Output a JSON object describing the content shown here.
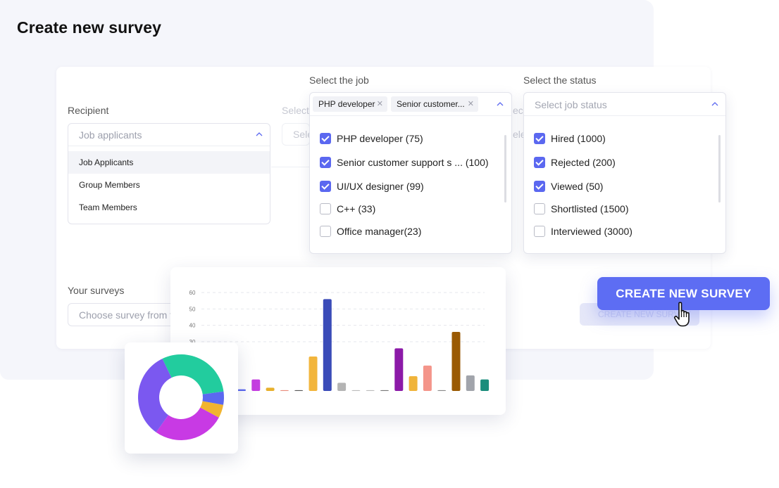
{
  "page": {
    "title": "Create new survey"
  },
  "recipient": {
    "label": "Recipient",
    "placeholder": "Job applicants",
    "options": [
      "Job Applicants",
      "Group Members",
      "Team Members"
    ]
  },
  "background_fields": {
    "select_label": "Select",
    "select_value": "Sele",
    "select_label_2": "ect",
    "select_value_2": "ele"
  },
  "job": {
    "label": "Select the job",
    "chips": [
      "PHP developer",
      "Senior customer..."
    ],
    "options": [
      {
        "label": "PHP developer (75)",
        "checked": true
      },
      {
        "label": "Senior customer support s ... (100)",
        "checked": true
      },
      {
        "label": "UI/UX designer (99)",
        "checked": true
      },
      {
        "label": "C++ (33)",
        "checked": false
      },
      {
        "label": "Office manager(23)",
        "checked": false
      }
    ]
  },
  "status": {
    "label": "Select the status",
    "placeholder": "Select job status",
    "options": [
      {
        "label": "Hired (1000)",
        "checked": true
      },
      {
        "label": "Rejected (200)",
        "checked": true
      },
      {
        "label": "Viewed (50)",
        "checked": true
      },
      {
        "label": "Shortlisted (1500)",
        "checked": false
      },
      {
        "label": "Interviewed (3000)",
        "checked": false
      }
    ]
  },
  "surveys": {
    "label": "Your surveys",
    "placeholder": "Choose survey from t"
  },
  "cta": {
    "label": "CREATE NEW SURVEY",
    "ghost_label": "CREATE NEW SURVEY"
  },
  "colors": {
    "accent": "#5d6df3",
    "checkbox": "#5b68f0"
  },
  "chart_data": [
    {
      "type": "bar",
      "yticks": [
        "60",
        "50",
        "40",
        "30"
      ],
      "ylim": [
        0,
        60
      ],
      "grid": true,
      "values": [
        1,
        7,
        2,
        0.5,
        0.5,
        21,
        56,
        5,
        0.5,
        0.5,
        0.5,
        26,
        9,
        15.5,
        0.5,
        36,
        9.5,
        7
      ],
      "colors": [
        "#5b68f0",
        "#c43ee0",
        "#e8b02c",
        "#e98a7a",
        "#555555",
        "#f2b53c",
        "#3a4bb8",
        "#b4b4b4",
        "#bbbbbb",
        "#bbbbbb",
        "#777777",
        "#8c1aa8",
        "#f0b43a",
        "#f4958a",
        "#888888",
        "#9a5a04",
        "#a1a4ab",
        "#1a8d7c"
      ]
    },
    {
      "type": "pie",
      "slices": [
        {
          "value": 30,
          "color": "#22cc9e"
        },
        {
          "value": 5,
          "color": "#5b68f0"
        },
        {
          "value": 5,
          "color": "#f1b42f"
        },
        {
          "value": 27,
          "color": "#c83ae4"
        },
        {
          "value": 33,
          "color": "#7b58f0"
        }
      ]
    }
  ]
}
